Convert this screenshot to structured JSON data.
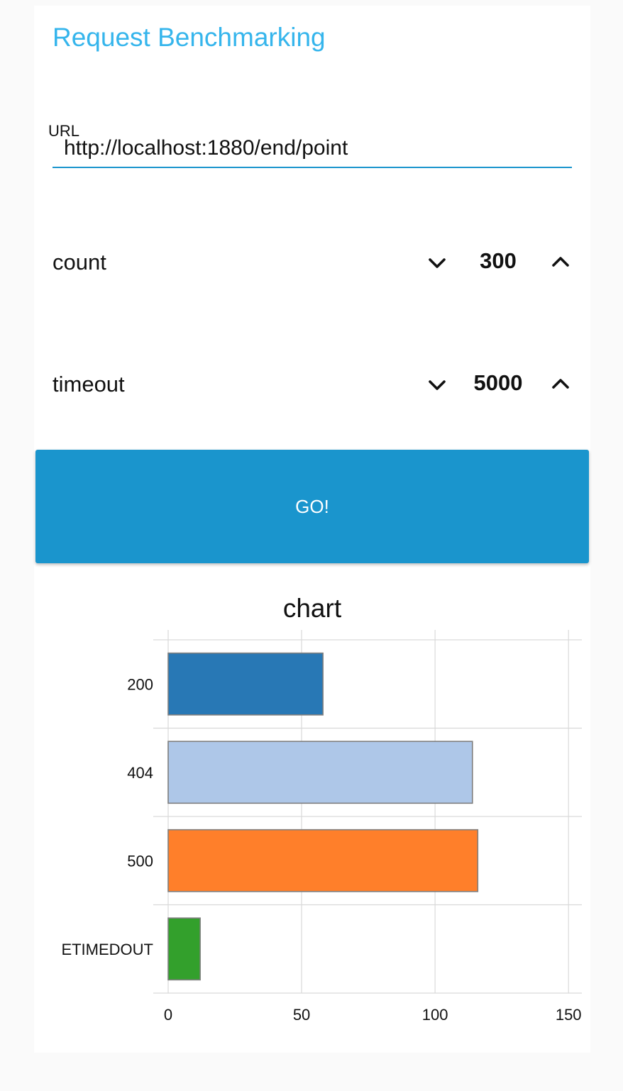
{
  "app": {
    "title": "Request Benchmarking"
  },
  "url_field": {
    "label": "URL",
    "value": "http://localhost:1880/end/point"
  },
  "count_field": {
    "label": "count",
    "value": "300",
    "decrement_icon": "chevron-down-icon",
    "increment_icon": "chevron-up-icon"
  },
  "timeout_field": {
    "label": "timeout",
    "value": "5000",
    "decrement_icon": "chevron-down-icon",
    "increment_icon": "chevron-up-icon"
  },
  "go_button": {
    "label": "GO!",
    "color": "#1a95cd"
  },
  "colors": {
    "title": "#35b5ec",
    "accent": "#1a95cd"
  },
  "chart_data": {
    "type": "bar",
    "orientation": "horizontal",
    "title": "chart",
    "xlabel": "",
    "ylabel": "",
    "categories": [
      "200",
      "404",
      "500",
      "ETIMEDOUT"
    ],
    "values": [
      58,
      114,
      116,
      12
    ],
    "colors": [
      "#2878b5",
      "#aec7e8",
      "#ff7f2a",
      "#33a02c"
    ],
    "xlim": [
      0,
      155
    ],
    "x_ticks": [
      0,
      50,
      100,
      150
    ],
    "grid": true,
    "legend": "none"
  }
}
